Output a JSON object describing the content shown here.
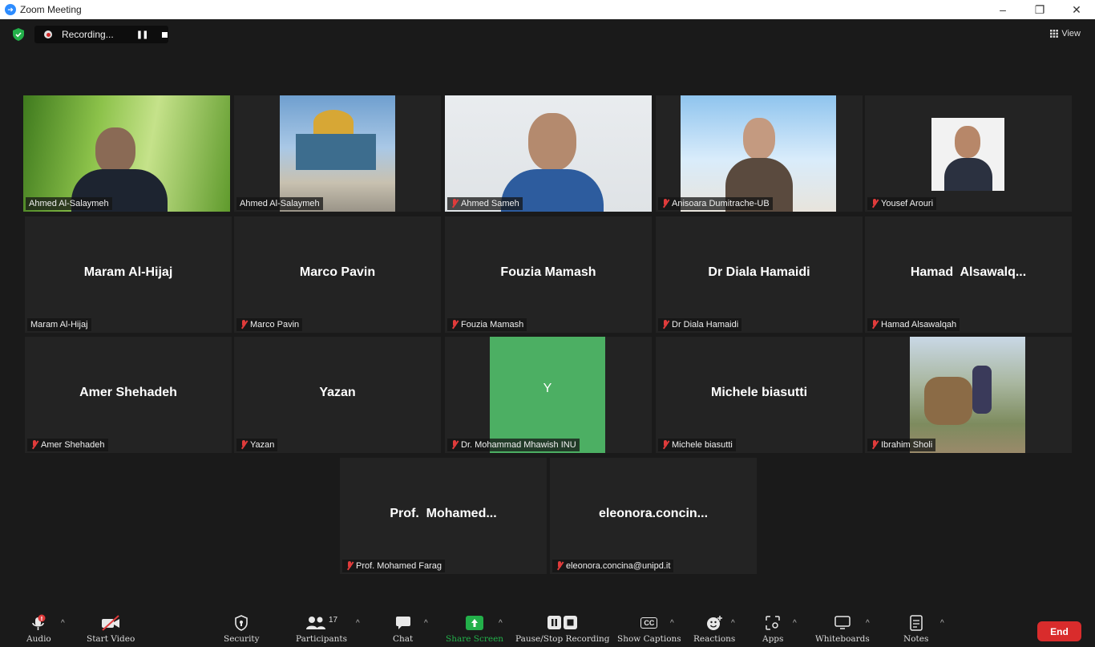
{
  "window": {
    "title": "Zoom Meeting",
    "minimize": "–",
    "restore": "❐",
    "close": "✕"
  },
  "recording": {
    "label": "Recording..."
  },
  "view_label": "View",
  "tiles": [
    {
      "display": "",
      "tag": "Ahmed Al-Salaymeh",
      "muted": false
    },
    {
      "display": "",
      "tag": "Ahmed Al-Salaymeh",
      "muted": false
    },
    {
      "display": "",
      "tag": "Ahmed Sameh",
      "muted": true
    },
    {
      "display": "",
      "tag": "Anisoara Dumitrache-UB",
      "muted": true
    },
    {
      "display": "",
      "tag": "Yousef Arouri",
      "muted": true
    },
    {
      "display": "Maram Al-Hijaj",
      "tag": "Maram Al-Hijaj",
      "muted": false
    },
    {
      "display": "Marco Pavin",
      "tag": "Marco Pavin",
      "muted": true
    },
    {
      "display": "Fouzia Mamash",
      "tag": "Fouzia Mamash",
      "muted": true
    },
    {
      "display": "Dr Diala Hamaidi",
      "tag": "Dr Diala Hamaidi",
      "muted": true
    },
    {
      "display": "Hamad  Alsawalq...",
      "tag": "Hamad Alsawalqah",
      "muted": true
    },
    {
      "display": "Amer Shehadeh",
      "tag": "Amer Shehadeh",
      "muted": true
    },
    {
      "display": "Yazan",
      "tag": "Yazan",
      "muted": true
    },
    {
      "display": "Y",
      "tag": "Dr. Mohammad Mhawish INU",
      "muted": true
    },
    {
      "display": "Michele biasutti",
      "tag": "Michele biasutti",
      "muted": true
    },
    {
      "display": "",
      "tag": "Ibrahim Sholi",
      "muted": true
    },
    {
      "display": "Prof.  Mohamed...",
      "tag": "Prof. Mohamed Farag",
      "muted": true
    },
    {
      "display": "eleonora.concin...",
      "tag": "eleonora.concina@unipd.it",
      "muted": true
    }
  ],
  "toolbar": {
    "audio": "Audio",
    "start_video": "Start Video",
    "security": "Security",
    "participants": "Participants",
    "participants_count": "17",
    "chat": "Chat",
    "share_screen": "Share Screen",
    "pause_stop_recording": "Pause/Stop Recording",
    "show_captions": "Show Captions",
    "captions_badge": "CC",
    "reactions": "Reactions",
    "apps": "Apps",
    "whiteboards": "Whiteboards",
    "notes": "Notes",
    "end": "End"
  },
  "colors": {
    "active_speaker": "#d6ea5a",
    "share_green": "#23b04a",
    "end_red": "#d92c2c",
    "avatar_green": "#4caf63",
    "mute_red": "#e03b3b"
  }
}
